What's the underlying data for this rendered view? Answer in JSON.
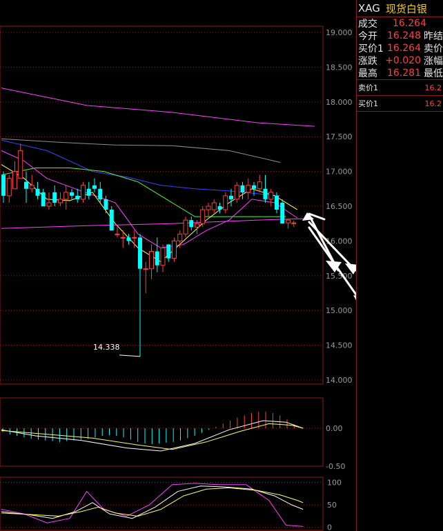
{
  "quote": {
    "symbol": "XAG",
    "name": "现货白银",
    "rows": [
      {
        "label": "成交",
        "value": "16.264",
        "label2": ""
      },
      {
        "label": "今开",
        "value": "16.248",
        "label2": "昨结"
      },
      {
        "label": "买价1",
        "value": "16.264",
        "label2": "卖价"
      },
      {
        "label": "涨跌",
        "value": "+0.020",
        "label2": "涨幅"
      },
      {
        "label": "最高",
        "value": "16.281",
        "label2": "最低"
      }
    ],
    "ask_row": {
      "label": "卖价1",
      "value": "16.2"
    },
    "bid_row": {
      "label": "买价1",
      "value": "16.2"
    }
  },
  "colors": {
    "up": "#ff4040",
    "down": "#00ffff",
    "grid": "#8b1a1a",
    "axis_text": "#9a9a9a",
    "ma_pink": "#ff40ff",
    "ma_gray": "#909090",
    "ma_blue": "#4040ff",
    "ma_green": "#40ff40",
    "ma_yellow": "#ffff60",
    "ma_white": "#ffffff",
    "arrow": "#ffffff"
  },
  "chart_data": [
    {
      "type": "candlestick",
      "name": "price",
      "ylim": [
        14.0,
        19.0
      ],
      "yticks": [
        "19.000",
        "18.500",
        "18.000",
        "17.500",
        "17.000",
        "16.500",
        "16.000",
        "15.500",
        "15.000",
        "14.500",
        "14.000"
      ],
      "annotations": [
        {
          "text": "14.338"
        }
      ],
      "candles": [
        [
          16.95,
          17.0,
          16.55,
          16.65
        ],
        [
          16.65,
          16.95,
          16.55,
          16.9
        ],
        [
          16.75,
          17.15,
          16.75,
          17.0
        ],
        [
          16.9,
          17.4,
          16.9,
          17.3
        ],
        [
          16.85,
          17.0,
          16.55,
          16.75
        ],
        [
          16.75,
          16.95,
          16.7,
          16.8
        ],
        [
          16.75,
          16.85,
          16.6,
          16.65
        ],
        [
          16.7,
          16.75,
          16.5,
          16.5
        ],
        [
          16.5,
          16.7,
          16.45,
          16.55
        ],
        [
          16.7,
          16.8,
          16.5,
          16.55
        ],
        [
          16.55,
          16.7,
          16.5,
          16.6
        ],
        [
          16.6,
          16.8,
          16.45,
          16.7
        ],
        [
          16.7,
          16.75,
          16.6,
          16.65
        ],
        [
          16.65,
          16.75,
          16.55,
          16.6
        ],
        [
          16.6,
          16.85,
          16.55,
          16.8
        ],
        [
          16.75,
          16.85,
          16.6,
          16.65
        ],
        [
          16.8,
          16.9,
          16.7,
          16.75
        ],
        [
          16.75,
          16.85,
          16.55,
          16.6
        ],
        [
          16.6,
          16.65,
          16.4,
          16.45
        ],
        [
          16.45,
          16.5,
          16.15,
          16.15
        ],
        [
          16.1,
          16.2,
          16.05,
          16.1
        ],
        [
          16.05,
          16.15,
          15.9,
          16.05
        ],
        [
          16.05,
          16.1,
          15.95,
          16.0
        ],
        [
          16.05,
          16.15,
          15.9,
          16.05
        ],
        [
          16.05,
          16.1,
          14.338,
          15.6
        ],
        [
          15.6,
          15.7,
          15.25,
          15.6
        ],
        [
          15.6,
          15.95,
          15.45,
          15.85
        ],
        [
          15.85,
          16.05,
          15.55,
          15.65
        ],
        [
          15.65,
          15.95,
          15.55,
          15.9
        ],
        [
          15.95,
          15.95,
          15.7,
          15.75
        ],
        [
          15.75,
          16.05,
          15.7,
          16.0
        ],
        [
          16.0,
          16.15,
          15.9,
          16.1
        ],
        [
          16.1,
          16.35,
          16.05,
          16.3
        ],
        [
          16.3,
          16.35,
          16.15,
          16.2
        ],
        [
          16.2,
          16.3,
          16.1,
          16.25
        ],
        [
          16.25,
          16.5,
          16.2,
          16.45
        ],
        [
          16.45,
          16.55,
          16.35,
          16.5
        ],
        [
          16.45,
          16.6,
          16.4,
          16.55
        ],
        [
          16.5,
          16.55,
          16.4,
          16.45
        ],
        [
          16.45,
          16.7,
          16.4,
          16.65
        ],
        [
          16.65,
          16.75,
          16.5,
          16.6
        ],
        [
          16.6,
          16.85,
          16.55,
          16.8
        ],
        [
          16.8,
          16.85,
          16.6,
          16.7
        ],
        [
          16.7,
          16.9,
          16.6,
          16.8
        ],
        [
          16.8,
          16.85,
          16.65,
          16.75
        ],
        [
          16.75,
          16.95,
          16.7,
          16.85
        ],
        [
          16.75,
          16.95,
          16.55,
          16.6
        ],
        [
          16.6,
          16.75,
          16.5,
          16.7
        ],
        [
          16.65,
          16.7,
          16.4,
          16.45
        ],
        [
          16.55,
          16.6,
          16.25,
          16.25
        ],
        [
          16.26,
          16.32,
          16.18,
          16.3
        ],
        [
          16.25,
          16.29,
          16.2,
          16.26
        ]
      ],
      "ma": [
        {
          "color": "ma_pink",
          "values": [
            [
              0,
              18.2
            ],
            [
              15,
              17.95
            ],
            [
              30,
              17.85
            ],
            [
              45,
              17.7
            ],
            [
              55,
              17.65
            ]
          ]
        },
        {
          "color": "ma_gray",
          "values": [
            [
              0,
              17.47
            ],
            [
              10,
              17.42
            ],
            [
              20,
              17.38
            ],
            [
              30,
              17.37
            ],
            [
              40,
              17.3
            ],
            [
              49,
              17.13
            ]
          ]
        },
        {
          "color": "ma_blue",
          "values": [
            [
              0,
              17.45
            ],
            [
              8,
              17.3
            ],
            [
              16,
              17.0
            ],
            [
              22,
              16.92
            ],
            [
              28,
              16.8
            ],
            [
              34,
              16.75
            ],
            [
              40,
              16.72
            ],
            [
              45,
              16.68
            ],
            [
              49,
              16.65
            ]
          ]
        },
        {
          "color": "ma_green",
          "values": [
            [
              0,
              16.95
            ],
            [
              6,
              17.05
            ],
            [
              12,
              17.05
            ],
            [
              18,
              17.0
            ],
            [
              24,
              16.85
            ],
            [
              30,
              16.55
            ],
            [
              34,
              16.35
            ],
            [
              38,
              16.35
            ],
            [
              44,
              16.35
            ],
            [
              50,
              16.35
            ]
          ]
        },
        {
          "color": "ma_pink",
          "values": [
            [
              0,
              17.3
            ],
            [
              4,
              17.15
            ],
            [
              8,
              16.9
            ],
            [
              14,
              16.72
            ],
            [
              20,
              16.55
            ],
            [
              24,
              16.1
            ],
            [
              28,
              15.9
            ],
            [
              32,
              15.95
            ],
            [
              36,
              16.15
            ],
            [
              40,
              16.3
            ],
            [
              44,
              16.6
            ],
            [
              48,
              16.55
            ],
            [
              52,
              16.33
            ]
          ]
        },
        {
          "color": "ma_yellow",
          "values": [
            [
              0,
              17.1
            ],
            [
              4,
              16.9
            ],
            [
              8,
              16.6
            ],
            [
              12,
              16.58
            ],
            [
              16,
              16.7
            ],
            [
              20,
              16.25
            ],
            [
              24,
              15.9
            ],
            [
              28,
              15.7
            ],
            [
              32,
              16.0
            ],
            [
              36,
              16.3
            ],
            [
              40,
              16.55
            ],
            [
              44,
              16.75
            ],
            [
              48,
              16.65
            ],
            [
              52,
              16.45
            ]
          ]
        },
        {
          "color": "ma_pink",
          "values": [
            [
              0,
              16.18
            ],
            [
              15,
              16.22
            ],
            [
              30,
              16.25
            ],
            [
              45,
              16.3
            ],
            [
              53,
              16.32
            ]
          ]
        }
      ]
    },
    {
      "type": "bar",
      "name": "macd",
      "ylim": [
        -0.5,
        0.4
      ],
      "yticks": [
        "0.00",
        "-0.50"
      ],
      "values": [
        -0.05,
        -0.08,
        -0.1,
        -0.12,
        -0.14,
        -0.15,
        -0.16,
        -0.17,
        -0.18,
        -0.17,
        -0.16,
        -0.15,
        -0.14,
        -0.12,
        -0.1,
        -0.09,
        -0.1,
        -0.12,
        -0.15,
        -0.18,
        -0.2,
        -0.21,
        -0.2,
        -0.19,
        -0.18,
        -0.16,
        -0.13,
        -0.1,
        -0.06,
        -0.02,
        0.02,
        0.06,
        0.1,
        0.14,
        0.17,
        0.2,
        0.22,
        0.22,
        0.2,
        0.17,
        0.12,
        0.05
      ],
      "dif": [
        [
          0,
          -0.02
        ],
        [
          6,
          -0.1
        ],
        [
          14,
          -0.16
        ],
        [
          22,
          -0.26
        ],
        [
          28,
          -0.3
        ],
        [
          34,
          -0.2
        ],
        [
          40,
          -0.02
        ],
        [
          46,
          0.1
        ],
        [
          50,
          0.08
        ],
        [
          53,
          0.0
        ]
      ],
      "dea": [
        [
          0,
          -0.03
        ],
        [
          8,
          -0.08
        ],
        [
          16,
          -0.13
        ],
        [
          24,
          -0.22
        ],
        [
          30,
          -0.28
        ],
        [
          36,
          -0.18
        ],
        [
          42,
          -0.04
        ],
        [
          47,
          0.06
        ],
        [
          51,
          0.04
        ],
        [
          53,
          0.0
        ]
      ]
    },
    {
      "type": "line",
      "name": "kdj",
      "ylim": [
        -5,
        110
      ],
      "yticks": [
        "100",
        "50",
        "0"
      ],
      "series": [
        {
          "color": "ma_pink",
          "values": [
            [
              0,
              40
            ],
            [
              4,
              30
            ],
            [
              8,
              10
            ],
            [
              12,
              20
            ],
            [
              15,
              80
            ],
            [
              18,
              40
            ],
            [
              22,
              25
            ],
            [
              26,
              50
            ],
            [
              30,
              95
            ],
            [
              34,
              98
            ],
            [
              38,
              95
            ],
            [
              43,
              95
            ],
            [
              47,
              60
            ],
            [
              50,
              5
            ],
            [
              53,
              2
            ]
          ]
        },
        {
          "color": "ma_white",
          "values": [
            [
              0,
              35
            ],
            [
              5,
              28
            ],
            [
              9,
              20
            ],
            [
              13,
              35
            ],
            [
              16,
              55
            ],
            [
              19,
              30
            ],
            [
              23,
              20
            ],
            [
              27,
              45
            ],
            [
              31,
              80
            ],
            [
              35,
              92
            ],
            [
              39,
              90
            ],
            [
              44,
              85
            ],
            [
              48,
              70
            ],
            [
              51,
              50
            ],
            [
              53,
              40
            ]
          ]
        },
        {
          "color": "ma_yellow",
          "values": [
            [
              0,
              32
            ],
            [
              6,
              28
            ],
            [
              10,
              25
            ],
            [
              14,
              35
            ],
            [
              17,
              45
            ],
            [
              20,
              32
            ],
            [
              24,
              25
            ],
            [
              28,
              40
            ],
            [
              32,
              70
            ],
            [
              36,
              85
            ],
            [
              40,
              88
            ],
            [
              45,
              82
            ],
            [
              49,
              72
            ],
            [
              52,
              60
            ],
            [
              53,
              55
            ]
          ]
        }
      ]
    }
  ]
}
